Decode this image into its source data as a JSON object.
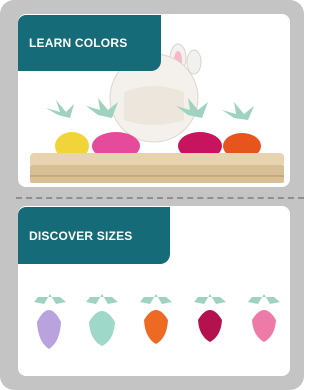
{
  "sections": {
    "top": {
      "label": "LEARN COLORS"
    },
    "bottom": {
      "label": "DISCOVER SIZES"
    }
  },
  "colors": {
    "frame": "#c4c4c4",
    "label_bg": "#156b78",
    "leaf": "#9fd3bf",
    "carrots_top": [
      "#f0d43a",
      "#e64a9a",
      "#c8145e",
      "#e8541e"
    ],
    "carrots_bottom": [
      "#b9a3df",
      "#9ed8c8",
      "#ee6a22",
      "#b3124f",
      "#ee7aa8"
    ]
  }
}
